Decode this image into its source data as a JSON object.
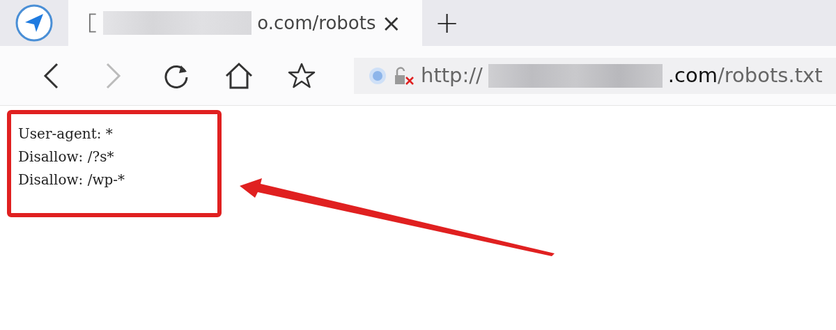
{
  "tab": {
    "title": "o.com/robots",
    "close": "×",
    "selected": true
  },
  "new_tab": "+",
  "address_bar": {
    "scheme": "http://",
    "domain_suffix": ".com",
    "path": "/robots.txt",
    "secure": false
  },
  "content": {
    "lines": [
      "User-agent: *",
      "Disallow: /?s*",
      "Disallow: /wp-*"
    ]
  },
  "annotation": {
    "kind": "highlight-with-arrow",
    "color": "#e02020"
  }
}
